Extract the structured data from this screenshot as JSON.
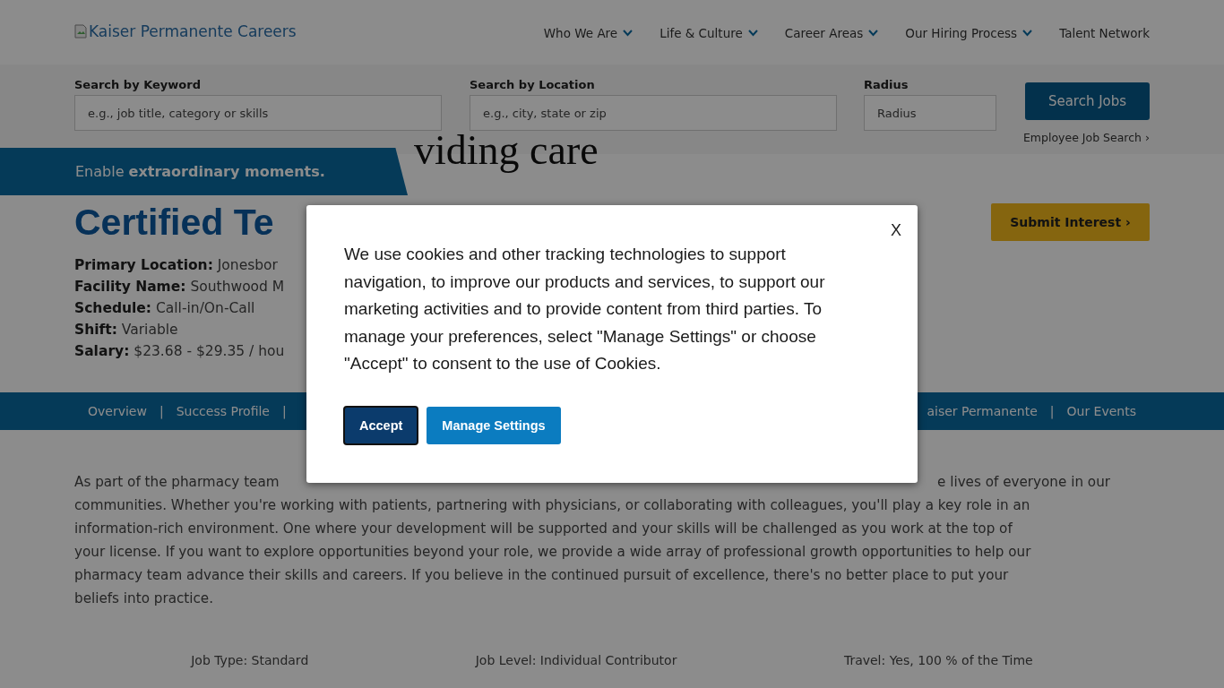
{
  "header": {
    "logo_alt": "Kaiser Permanente Careers",
    "nav": [
      {
        "label": "Who We Are",
        "has_menu": true
      },
      {
        "label": "Life & Culture",
        "has_menu": true
      },
      {
        "label": "Career Areas",
        "has_menu": true
      },
      {
        "label": "Our Hiring Process",
        "has_menu": true
      },
      {
        "label": "Talent Network",
        "has_menu": false
      }
    ]
  },
  "search": {
    "fields": [
      {
        "label": "Search by Keyword",
        "placeholder": "e.g., job title, category or skills"
      },
      {
        "label": "Search by Location",
        "placeholder": "e.g., city, state or zip"
      },
      {
        "label": "Radius",
        "placeholder": "Radius"
      }
    ],
    "button": "Search Jobs",
    "employee_link": "Employee Job Search ›"
  },
  "hero": {
    "heading": "viding care",
    "banner": "Enable **extraordinary moments.**"
  },
  "job": {
    "title": "Certified Te",
    "submit": "Submit Interest ›",
    "details": [
      "**Primary Location:** Jonesbor",
      "**Facility Name:** Southwood M",
      "**Schedule:** Call-in/On-Call",
      "**Shift:** Variable",
      "**Salary:** $23.68 - $29.35 / hou"
    ]
  },
  "tabs": {
    "left": [
      {
        "kind": "tab",
        "text": "Overview"
      },
      {
        "kind": "separator",
        "text": "|"
      },
      {
        "kind": "tab",
        "text": "Success Profile"
      },
      {
        "kind": "separator",
        "text": "|"
      }
    ],
    "right": [
      {
        "kind": "tab",
        "text": "aiser Permanente"
      },
      {
        "kind": "separator",
        "text": "|"
      },
      {
        "kind": "tab",
        "text": "Our Events"
      }
    ]
  },
  "description": {
    "first_line_left": "As part of the pharmacy team",
    "first_line_right": "e lives of everyone in our",
    "lines": [
      "communities. Whether you're working with patients, partnering with physicians, or collaborating with colleagues, you'll play a key role in an",
      "information-rich environment. One where your development will be supported and your skills will be challenged as you work at the top of",
      "your license. If you want to explore opportunities beyond your role, we provide a wide array of professional growth opportunities to help our",
      "pharmacy team advance their skills and careers. If you believe in the continued pursuit of excellence, there's no better place to put your",
      "beliefs into practice."
    ]
  },
  "facts": [
    "Job Type: Standard",
    "Job Level: Individual Contributor",
    "Travel: Yes, 100 % of the Time"
  ],
  "cookie_dialog": {
    "close": "X",
    "text": "We use cookies and other tracking technologies to support navigation, to improve our products and services, to support our marketing activities and to provide content from third parties. To manage your preferences, select \"Manage Settings\" or choose \"Accept\" to consent to the use of Cookies.",
    "buttons": [
      {
        "label": "Accept",
        "kind": "primary",
        "focused": true
      },
      {
        "label": "Manage Settings",
        "kind": "secondary",
        "focused": false
      }
    ]
  }
}
